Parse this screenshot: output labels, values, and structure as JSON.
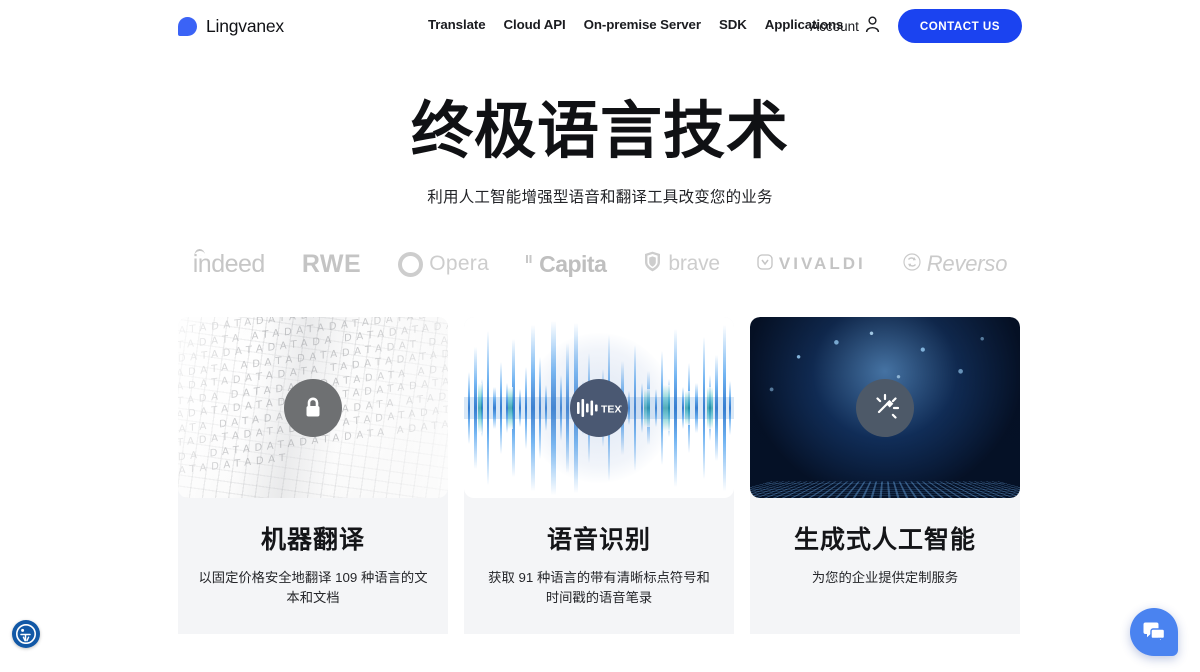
{
  "brand": {
    "name": "Lingvanex",
    "logo_icon": "lingvanex-drop-logo",
    "color": "#3b63f6"
  },
  "nav": {
    "items": [
      {
        "label": "Translate"
      },
      {
        "label": "Cloud API"
      },
      {
        "label": "On-premise Server"
      },
      {
        "label": "SDK"
      },
      {
        "label": "Applications"
      }
    ]
  },
  "header_right": {
    "account_label": "Account",
    "account_icon": "person-icon",
    "contact_label": "CONTACT US",
    "contact_color": "#1b43f0"
  },
  "hero": {
    "title": "终极语言技术",
    "subtitle": "利用人工智能增强型语音和翻译工具改变您的业务"
  },
  "logos": {
    "items": [
      {
        "name": "indeed",
        "label": "indeed"
      },
      {
        "name": "rwe",
        "label": "RWE"
      },
      {
        "name": "opera",
        "label": "Opera"
      },
      {
        "name": "capita",
        "label": "Capita"
      },
      {
        "name": "brave",
        "label": "brave"
      },
      {
        "name": "vivaldi",
        "label": "VIVALDI"
      },
      {
        "name": "reverso",
        "label": "Reverso"
      }
    ]
  },
  "cards": [
    {
      "title": "机器翻译",
      "desc": "以固定价格安全地翻译 109 种语言的文本和文档",
      "icon": "lock-shield-icon",
      "media": "data-letters-wave-image",
      "glyphs": "DATADATADATADATA DATADATADATADATA ATADATADATADATAD TADATADATADATADA DATADATADATADATA ADATADATADATADAT DATADATADATADATA TADATADATADATADA DATADATADATADATA ADATADATADATADAT DATADATADATADATA DATADATADATADATA ATADATADATADATAD TADATADATADATADA DATADATADATADATA ADATADATADATADAT"
    },
    {
      "title": "语音识别",
      "desc": "获取 91 种语言的带有清晰标点符号和时间戳的语音笔录",
      "icon": "audio-to-text-icon",
      "icon_text": "TEXT",
      "media": "blue-audio-waveform-image"
    },
    {
      "title": "生成式人工智能",
      "desc": "为您的企业提供定制服务",
      "icon": "magic-wand-sparkle-icon",
      "media": "blue-digital-particles-image"
    }
  ],
  "widgets": {
    "accessibility_label": "accessibility-widget",
    "accessibility_icon": "accessibility-icon",
    "chat_label": "chat-widget",
    "chat_icon": "chat-bubble-icon"
  }
}
